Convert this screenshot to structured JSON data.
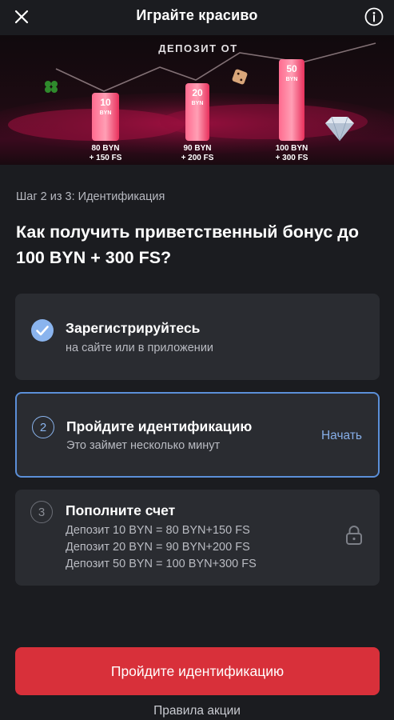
{
  "header": {
    "title": "Играйте красиво",
    "close_icon": "close-icon",
    "info_icon": "info-icon"
  },
  "banner": {
    "caption": "ДЕПОЗИТ ОТ",
    "tiers": [
      {
        "amount": "10",
        "currency": "BYN",
        "bonus_line1": "80 BYN",
        "bonus_line2": "+ 150 FS"
      },
      {
        "amount": "20",
        "currency": "BYN",
        "bonus_line1": "90 BYN",
        "bonus_line2": "+ 200 FS"
      },
      {
        "amount": "50",
        "currency": "BYN",
        "bonus_line1": "100 BYN",
        "bonus_line2": "+ 300 FS"
      }
    ],
    "decor_icons": [
      "clover-icon",
      "dice-icon",
      "diamond-icon"
    ]
  },
  "step_label": "Шаг 2 из 3: Идентификация",
  "headline": "Как получить приветственный бонус до 100 BYN + 300 FS?",
  "steps": [
    {
      "state": "done",
      "title": "Зарегистрируйтесь",
      "subtitle": "на сайте или в приложении"
    },
    {
      "state": "active",
      "number": "2",
      "title": "Пройдите идентификацию",
      "subtitle": "Это займет несколько минут",
      "action": "Начать"
    },
    {
      "state": "locked",
      "number": "3",
      "title": "Пополните счет",
      "lines": [
        "Депозит 10 BYN = 80 BYN+150 FS",
        "Депозит 20 BYN = 90 BYN+200 FS",
        "Депозит 50 BYN = 100 BYN+300 FS"
      ]
    }
  ],
  "cta_label": "Пройдите идентификацию",
  "rules_link": "Правила акции",
  "colors": {
    "background": "#1b1c20",
    "card": "#2a2c31",
    "accent_blue": "#5b8fd8",
    "cta_red": "#d8303a",
    "check_blue": "#8ab4ee"
  }
}
